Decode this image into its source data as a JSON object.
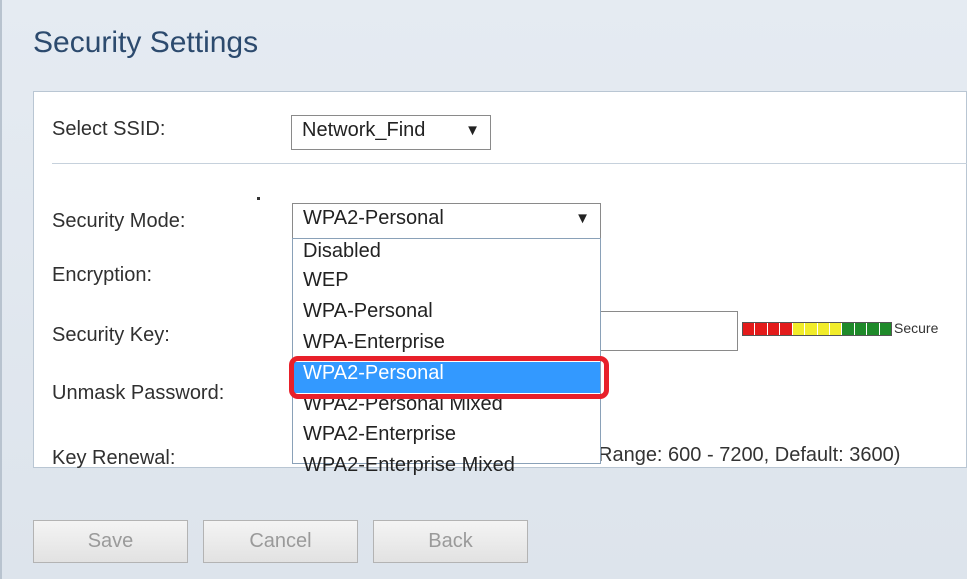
{
  "page": {
    "title": "Security Settings"
  },
  "ssid": {
    "label": "Select SSID:",
    "value": "Network_Find"
  },
  "security_mode": {
    "label": "Security Mode:",
    "value": "WPA2-Personal",
    "options": [
      "Disabled",
      "WEP",
      "WPA-Personal",
      "WPA-Enterprise",
      "WPA2-Personal",
      "WPA2-Personal Mixed",
      "WPA2-Enterprise",
      "WPA2-Enterprise Mixed"
    ],
    "selected_index": 4
  },
  "encryption": {
    "label": "Encryption:"
  },
  "security_key": {
    "label": "Security Key:",
    "strength_text": "Secure",
    "strength_colors": [
      "#e31b1b",
      "#e31b1b",
      "#e31b1b",
      "#e31b1b",
      "#f1ec2a",
      "#f1ec2a",
      "#f1ec2a",
      "#f1ec2a",
      "#1f8a2a",
      "#1f8a2a",
      "#1f8a2a",
      "#1f8a2a"
    ]
  },
  "unmask_password": {
    "label": "Unmask Password:"
  },
  "key_renewal": {
    "label": "Key Renewal:",
    "hint": "Range: 600 - 7200, Default: 3600)"
  },
  "buttons": {
    "save": "Save",
    "cancel": "Cancel",
    "back": "Back"
  },
  "colors": {
    "highlight": "#e8202a",
    "selected_option": "#3399ff",
    "title": "#2c4a6e"
  }
}
